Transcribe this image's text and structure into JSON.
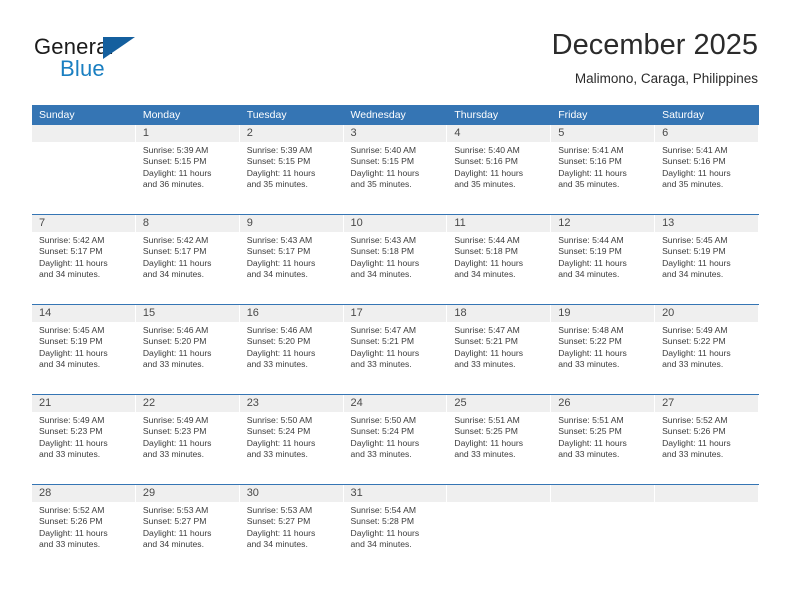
{
  "brand": {
    "name_part1": "General",
    "name_part2": "Blue",
    "triangle_color": "#145f9e",
    "blue_color": "#1a7fc1"
  },
  "header": {
    "title": "December 2025",
    "subtitle": "Malimono, Caraga, Philippines"
  },
  "theme": {
    "header_row_bg": "#3575b4",
    "day_band_bg": "#efefef",
    "text_color": "#3c3c3c"
  },
  "calendar": {
    "weekday_headers": [
      "Sunday",
      "Monday",
      "Tuesday",
      "Wednesday",
      "Thursday",
      "Friday",
      "Saturday"
    ],
    "weeks": [
      [
        {
          "day": "",
          "lines": []
        },
        {
          "day": "1",
          "lines": [
            "Sunrise: 5:39 AM",
            "Sunset: 5:15 PM",
            "Daylight: 11 hours",
            "and 36 minutes."
          ]
        },
        {
          "day": "2",
          "lines": [
            "Sunrise: 5:39 AM",
            "Sunset: 5:15 PM",
            "Daylight: 11 hours",
            "and 35 minutes."
          ]
        },
        {
          "day": "3",
          "lines": [
            "Sunrise: 5:40 AM",
            "Sunset: 5:15 PM",
            "Daylight: 11 hours",
            "and 35 minutes."
          ]
        },
        {
          "day": "4",
          "lines": [
            "Sunrise: 5:40 AM",
            "Sunset: 5:16 PM",
            "Daylight: 11 hours",
            "and 35 minutes."
          ]
        },
        {
          "day": "5",
          "lines": [
            "Sunrise: 5:41 AM",
            "Sunset: 5:16 PM",
            "Daylight: 11 hours",
            "and 35 minutes."
          ]
        },
        {
          "day": "6",
          "lines": [
            "Sunrise: 5:41 AM",
            "Sunset: 5:16 PM",
            "Daylight: 11 hours",
            "and 35 minutes."
          ]
        }
      ],
      [
        {
          "day": "7",
          "lines": [
            "Sunrise: 5:42 AM",
            "Sunset: 5:17 PM",
            "Daylight: 11 hours",
            "and 34 minutes."
          ]
        },
        {
          "day": "8",
          "lines": [
            "Sunrise: 5:42 AM",
            "Sunset: 5:17 PM",
            "Daylight: 11 hours",
            "and 34 minutes."
          ]
        },
        {
          "day": "9",
          "lines": [
            "Sunrise: 5:43 AM",
            "Sunset: 5:17 PM",
            "Daylight: 11 hours",
            "and 34 minutes."
          ]
        },
        {
          "day": "10",
          "lines": [
            "Sunrise: 5:43 AM",
            "Sunset: 5:18 PM",
            "Daylight: 11 hours",
            "and 34 minutes."
          ]
        },
        {
          "day": "11",
          "lines": [
            "Sunrise: 5:44 AM",
            "Sunset: 5:18 PM",
            "Daylight: 11 hours",
            "and 34 minutes."
          ]
        },
        {
          "day": "12",
          "lines": [
            "Sunrise: 5:44 AM",
            "Sunset: 5:19 PM",
            "Daylight: 11 hours",
            "and 34 minutes."
          ]
        },
        {
          "day": "13",
          "lines": [
            "Sunrise: 5:45 AM",
            "Sunset: 5:19 PM",
            "Daylight: 11 hours",
            "and 34 minutes."
          ]
        }
      ],
      [
        {
          "day": "14",
          "lines": [
            "Sunrise: 5:45 AM",
            "Sunset: 5:19 PM",
            "Daylight: 11 hours",
            "and 34 minutes."
          ]
        },
        {
          "day": "15",
          "lines": [
            "Sunrise: 5:46 AM",
            "Sunset: 5:20 PM",
            "Daylight: 11 hours",
            "and 33 minutes."
          ]
        },
        {
          "day": "16",
          "lines": [
            "Sunrise: 5:46 AM",
            "Sunset: 5:20 PM",
            "Daylight: 11 hours",
            "and 33 minutes."
          ]
        },
        {
          "day": "17",
          "lines": [
            "Sunrise: 5:47 AM",
            "Sunset: 5:21 PM",
            "Daylight: 11 hours",
            "and 33 minutes."
          ]
        },
        {
          "day": "18",
          "lines": [
            "Sunrise: 5:47 AM",
            "Sunset: 5:21 PM",
            "Daylight: 11 hours",
            "and 33 minutes."
          ]
        },
        {
          "day": "19",
          "lines": [
            "Sunrise: 5:48 AM",
            "Sunset: 5:22 PM",
            "Daylight: 11 hours",
            "and 33 minutes."
          ]
        },
        {
          "day": "20",
          "lines": [
            "Sunrise: 5:49 AM",
            "Sunset: 5:22 PM",
            "Daylight: 11 hours",
            "and 33 minutes."
          ]
        }
      ],
      [
        {
          "day": "21",
          "lines": [
            "Sunrise: 5:49 AM",
            "Sunset: 5:23 PM",
            "Daylight: 11 hours",
            "and 33 minutes."
          ]
        },
        {
          "day": "22",
          "lines": [
            "Sunrise: 5:49 AM",
            "Sunset: 5:23 PM",
            "Daylight: 11 hours",
            "and 33 minutes."
          ]
        },
        {
          "day": "23",
          "lines": [
            "Sunrise: 5:50 AM",
            "Sunset: 5:24 PM",
            "Daylight: 11 hours",
            "and 33 minutes."
          ]
        },
        {
          "day": "24",
          "lines": [
            "Sunrise: 5:50 AM",
            "Sunset: 5:24 PM",
            "Daylight: 11 hours",
            "and 33 minutes."
          ]
        },
        {
          "day": "25",
          "lines": [
            "Sunrise: 5:51 AM",
            "Sunset: 5:25 PM",
            "Daylight: 11 hours",
            "and 33 minutes."
          ]
        },
        {
          "day": "26",
          "lines": [
            "Sunrise: 5:51 AM",
            "Sunset: 5:25 PM",
            "Daylight: 11 hours",
            "and 33 minutes."
          ]
        },
        {
          "day": "27",
          "lines": [
            "Sunrise: 5:52 AM",
            "Sunset: 5:26 PM",
            "Daylight: 11 hours",
            "and 33 minutes."
          ]
        }
      ],
      [
        {
          "day": "28",
          "lines": [
            "Sunrise: 5:52 AM",
            "Sunset: 5:26 PM",
            "Daylight: 11 hours",
            "and 33 minutes."
          ]
        },
        {
          "day": "29",
          "lines": [
            "Sunrise: 5:53 AM",
            "Sunset: 5:27 PM",
            "Daylight: 11 hours",
            "and 34 minutes."
          ]
        },
        {
          "day": "30",
          "lines": [
            "Sunrise: 5:53 AM",
            "Sunset: 5:27 PM",
            "Daylight: 11 hours",
            "and 34 minutes."
          ]
        },
        {
          "day": "31",
          "lines": [
            "Sunrise: 5:54 AM",
            "Sunset: 5:28 PM",
            "Daylight: 11 hours",
            "and 34 minutes."
          ]
        },
        {
          "day": "",
          "lines": []
        },
        {
          "day": "",
          "lines": []
        },
        {
          "day": "",
          "lines": []
        }
      ]
    ]
  }
}
